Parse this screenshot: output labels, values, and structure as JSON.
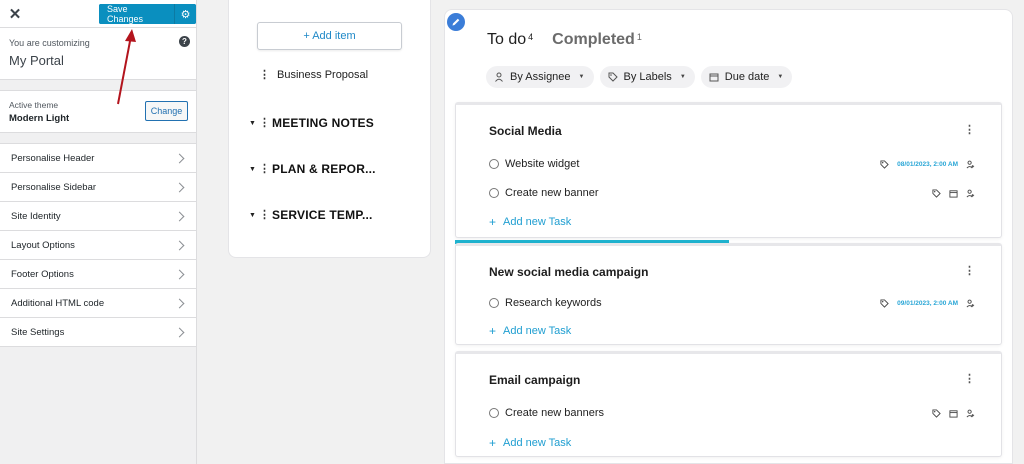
{
  "customizer": {
    "close_label": "✕",
    "save_label": "Save Changes",
    "customizing_label": "You are customizing",
    "site_name": "My Portal",
    "help_label": "?",
    "active_theme_label": "Active theme",
    "theme_name": "Modern Light",
    "change_label": "Change",
    "menu": [
      {
        "label": "Personalise Header"
      },
      {
        "label": "Personalise Sidebar"
      },
      {
        "label": "Site Identity"
      },
      {
        "label": "Layout Options"
      },
      {
        "label": "Footer Options"
      },
      {
        "label": "Additional HTML code"
      },
      {
        "label": "Site Settings"
      }
    ]
  },
  "list_panel": {
    "add_item_label": "+ Add item",
    "plain_item": "Business Proposal",
    "groups": [
      {
        "label": "MEETING NOTES"
      },
      {
        "label": "PLAN & REPOR..."
      },
      {
        "label": "SERVICE TEMP..."
      }
    ]
  },
  "board": {
    "tabs": [
      {
        "label": "To do",
        "count": "4",
        "active": true
      },
      {
        "label": "Completed",
        "count": "1",
        "active": false
      }
    ],
    "filters": [
      {
        "label": "By Assignee",
        "icon": "person-icon"
      },
      {
        "label": "By Labels",
        "icon": "tag-icon"
      },
      {
        "label": "Due date",
        "icon": "calendar-icon"
      }
    ],
    "add_task_label": "Add new Task",
    "progress_fraction": 0.5,
    "accent": "#1f9ed1",
    "cards": [
      {
        "title": "Social Media",
        "tasks": [
          {
            "name": "Website widget",
            "date": "08/01/2023, 2:00 AM"
          },
          {
            "name": "Create new banner",
            "date": ""
          }
        ]
      },
      {
        "title": "New social media campaign",
        "tasks": [
          {
            "name": "Research keywords",
            "date": "09/01/2023, 2:00 AM"
          }
        ]
      },
      {
        "title": "Email campaign",
        "tasks": [
          {
            "name": "Create new banners",
            "date": ""
          }
        ]
      }
    ]
  }
}
